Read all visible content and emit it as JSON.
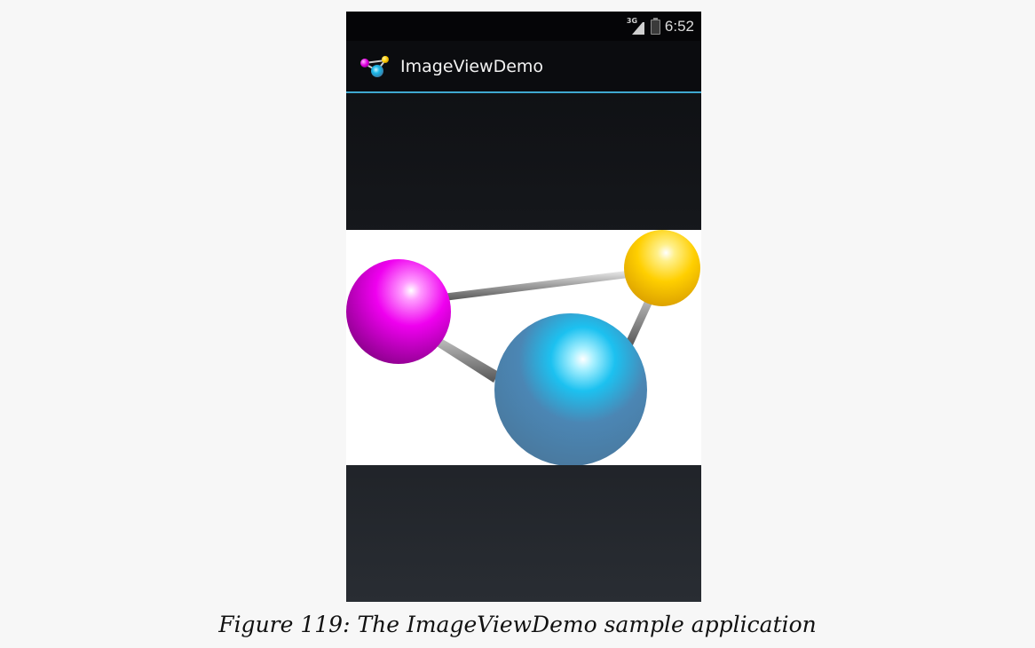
{
  "status_bar": {
    "network_label": "3G",
    "time": "6:52",
    "icons": [
      "signal-icon",
      "battery-icon"
    ]
  },
  "action_bar": {
    "app_icon": "molecule-icon",
    "title": "ImageViewDemo",
    "accent_color": "#3fa7cf"
  },
  "image_view": {
    "content": "molecule-image",
    "colors": {
      "magenta": "#e000e0",
      "yellow": "#ffcc00",
      "blue": "#4a7fa8",
      "highlight_blue": "#19b7e8"
    }
  },
  "caption": {
    "text": "Figure 119: The ImageViewDemo sample application"
  }
}
